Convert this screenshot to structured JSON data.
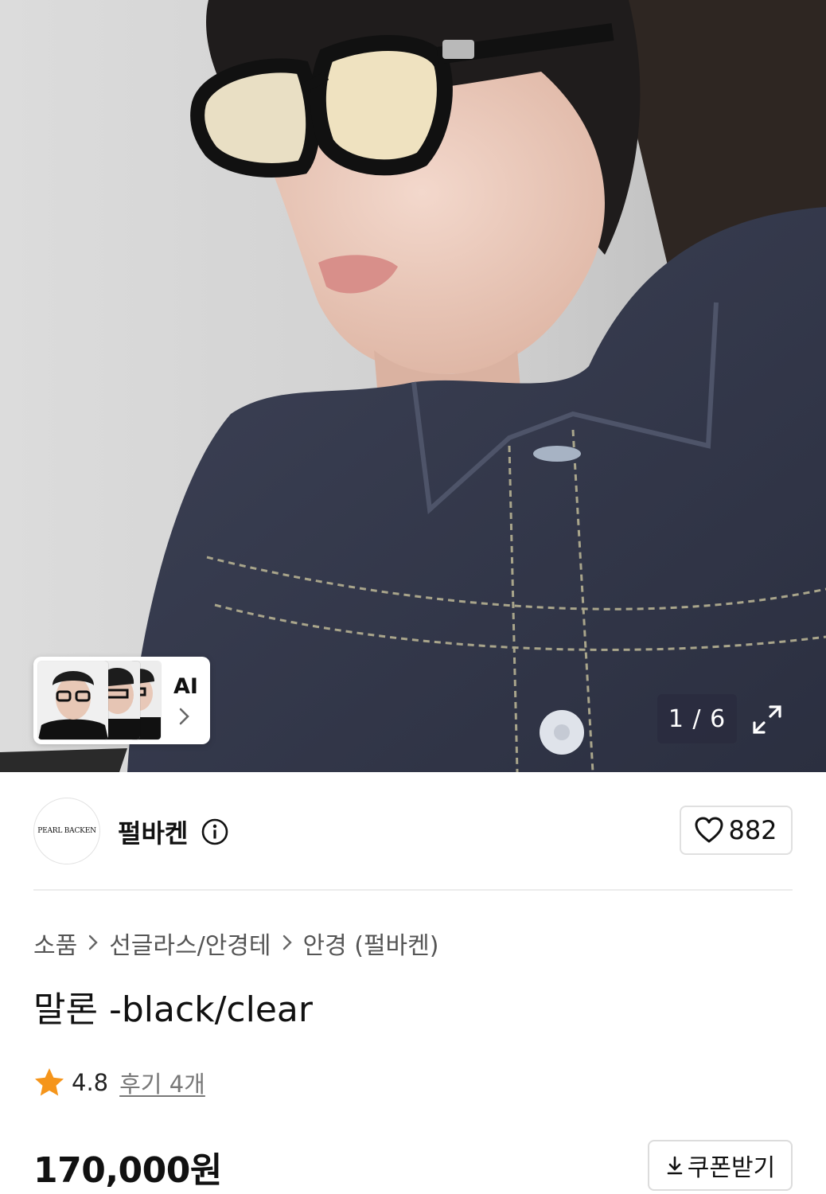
{
  "gallery": {
    "pager": "1 / 6",
    "ai_label": "AI",
    "icons": {
      "expand": "expand-icon",
      "chevron": "chevron-right-icon"
    }
  },
  "brand": {
    "logo_text": "PEARL BACKEN",
    "name": "펄바켄",
    "like_count": "882"
  },
  "breadcrumb": [
    "소품",
    "선글라스/안경테",
    "안경 (펄바켄)"
  ],
  "product": {
    "title": "말론 -black/clear",
    "rating": "4.8",
    "reviews_label": "후기 4개",
    "price": "170,000원",
    "coupon_label": "쿠폰받기"
  },
  "colors": {
    "star": "#f5951b",
    "text": "#111111",
    "muted": "#555555"
  }
}
